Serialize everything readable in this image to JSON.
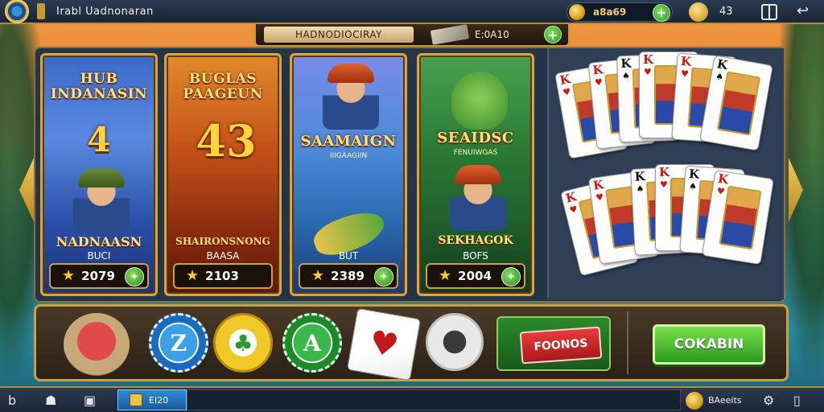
{
  "header": {
    "title": "Irabl Uadnonaran",
    "coins": "a8a69",
    "level": "43",
    "icons": [
      "globe-badge-icon",
      "flag-icon",
      "coin-icon",
      "plus-icon",
      "avatar-icon",
      "gift-icon",
      "back-icon"
    ]
  },
  "subbar": {
    "label": "HADNODIOCIRAY",
    "value": "E:0A10"
  },
  "games": [
    {
      "title": "HUB INDANASIN",
      "number": "4",
      "name": "NADNAASN",
      "tag": "BUCI",
      "score": "2079"
    },
    {
      "title": "BUGLAS PAAGEUN",
      "number": "43",
      "name": "SHAIRONSNONG",
      "tag": "BAASA",
      "score": "2103"
    },
    {
      "title": "SAAMAIGN",
      "subtitle": "IIIGAAGIIN",
      "tag": "BUT",
      "score": "2389"
    },
    {
      "title": "SEAIDSC",
      "subtitle": "FENUIWGAS",
      "name": "SEKHAGOK",
      "tag": "BOFS",
      "score": "2004"
    }
  ],
  "playing_cards": {
    "row1": [
      "K",
      "K",
      "K",
      "K",
      "K",
      "K"
    ],
    "row2": [
      "K",
      "K",
      "K",
      "K",
      "K",
      "K"
    ]
  },
  "bottom": {
    "chips": [
      "Z",
      "♣",
      "A"
    ],
    "promo_label": "FOONOS",
    "cta_label": "COKABIN"
  },
  "footer": {
    "tab_label": "EI20",
    "right_label": "BAeeits"
  },
  "colors": {
    "accent_gold": "#c9a04a",
    "cta_green": "#2a9a20",
    "topbar": "#1a2536"
  }
}
